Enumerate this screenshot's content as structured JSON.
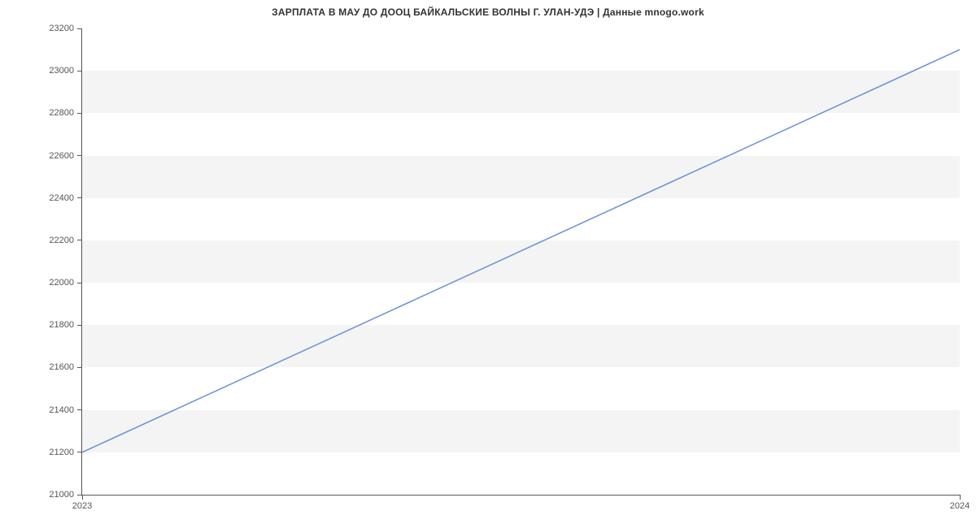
{
  "chart_data": {
    "type": "line",
    "title": "ЗАРПЛАТА В МАУ ДО ДООЦ БАЙКАЛЬСКИЕ ВОЛНЫ Г. УЛАН-УДЭ | Данные mnogo.work",
    "xlabel": "",
    "ylabel": "",
    "x": [
      2023,
      2024
    ],
    "values": [
      21200,
      23100
    ],
    "xlim": [
      2023,
      2024
    ],
    "ylim": [
      21000,
      23200
    ],
    "y_ticks": [
      21000,
      21200,
      21400,
      21600,
      21800,
      22000,
      22200,
      22400,
      22600,
      22800,
      23000,
      23200
    ],
    "x_ticks": [
      2023,
      2024
    ],
    "line_color": "#6b8fd6",
    "band_color": "#f4f4f4"
  }
}
